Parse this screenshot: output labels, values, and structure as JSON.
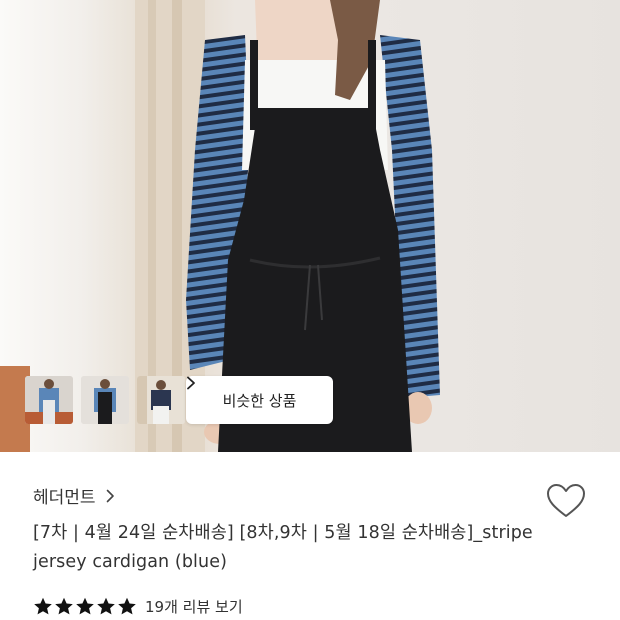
{
  "photo": {
    "alt": "",
    "thumbnails": [
      {
        "name": "thumbnail-1"
      },
      {
        "name": "thumbnail-2"
      },
      {
        "name": "thumbnail-3"
      }
    ],
    "similar_button_label": "비슷한 상품",
    "similar_button_icon": "chevron-right-icon"
  },
  "product": {
    "brand": "헤더먼트",
    "brand_icon": "chevron-right-icon",
    "title": "[7차 | 4월 24일 순차배송] [8차,9차 | 5월 18일 순차배송]_stripe jersey cardigan (blue)",
    "wishlist_icon": "heart-icon",
    "rating": {
      "stars": 5,
      "max": 5,
      "star_color": "#111111",
      "review_text": "19개 리뷰 보기"
    }
  },
  "colors": {
    "stripe_blue": "#5a86b8",
    "stripe_navy": "#1f2c44",
    "overalls": "#1b1b1d"
  }
}
